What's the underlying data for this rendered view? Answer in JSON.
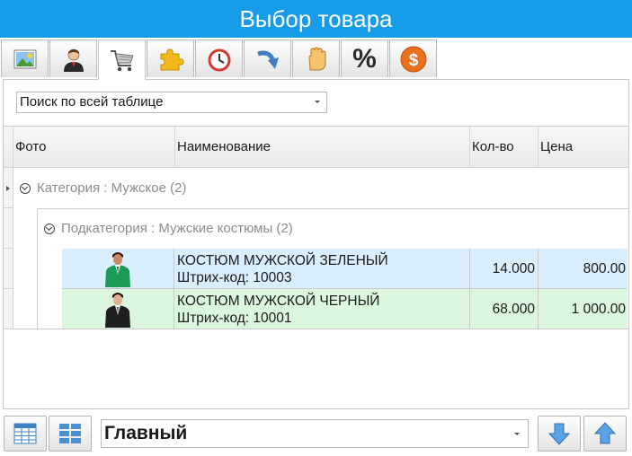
{
  "window": {
    "title": "Выбор товара"
  },
  "tabs": [
    {
      "icon": "picture-icon"
    },
    {
      "icon": "user-icon"
    },
    {
      "icon": "shopping-cart-icon"
    },
    {
      "icon": "puzzle-icon"
    },
    {
      "icon": "clock-icon"
    },
    {
      "icon": "redo-arrow-icon"
    },
    {
      "icon": "hand-icon"
    },
    {
      "icon": "percent-icon",
      "label": "%"
    },
    {
      "icon": "dollar-coin-icon",
      "label": "$"
    }
  ],
  "search": {
    "placeholder": "Поиск по всей таблице"
  },
  "table": {
    "columns": {
      "photo": "Фото",
      "name": "Наименование",
      "qty": "Кол-во",
      "price": "Цена"
    },
    "group": {
      "label": "Категория : Мужское (2)"
    },
    "subgroup": {
      "label": "Подкатегория : Мужские костюмы (2)"
    },
    "rows": [
      {
        "name": "КОСТЮМ МУЖСКОЙ ЗЕЛЕНЫЙ",
        "barcode": "Штрих-код: 10003",
        "qty": "14.000",
        "price": "800.00",
        "suit_color": "#1c9a58"
      },
      {
        "name": "КОСТЮМ МУЖСКОЙ ЧЕРНЫЙ",
        "barcode": "Штрих-код: 10001",
        "qty": "68.000",
        "price": "1 000.00",
        "suit_color": "#1f1f1f"
      }
    ]
  },
  "footer": {
    "view": "Главный"
  },
  "colors": {
    "title_bar": "#169ce8",
    "row_selected": "#d9efff",
    "row_alt": "#dbf8df"
  }
}
